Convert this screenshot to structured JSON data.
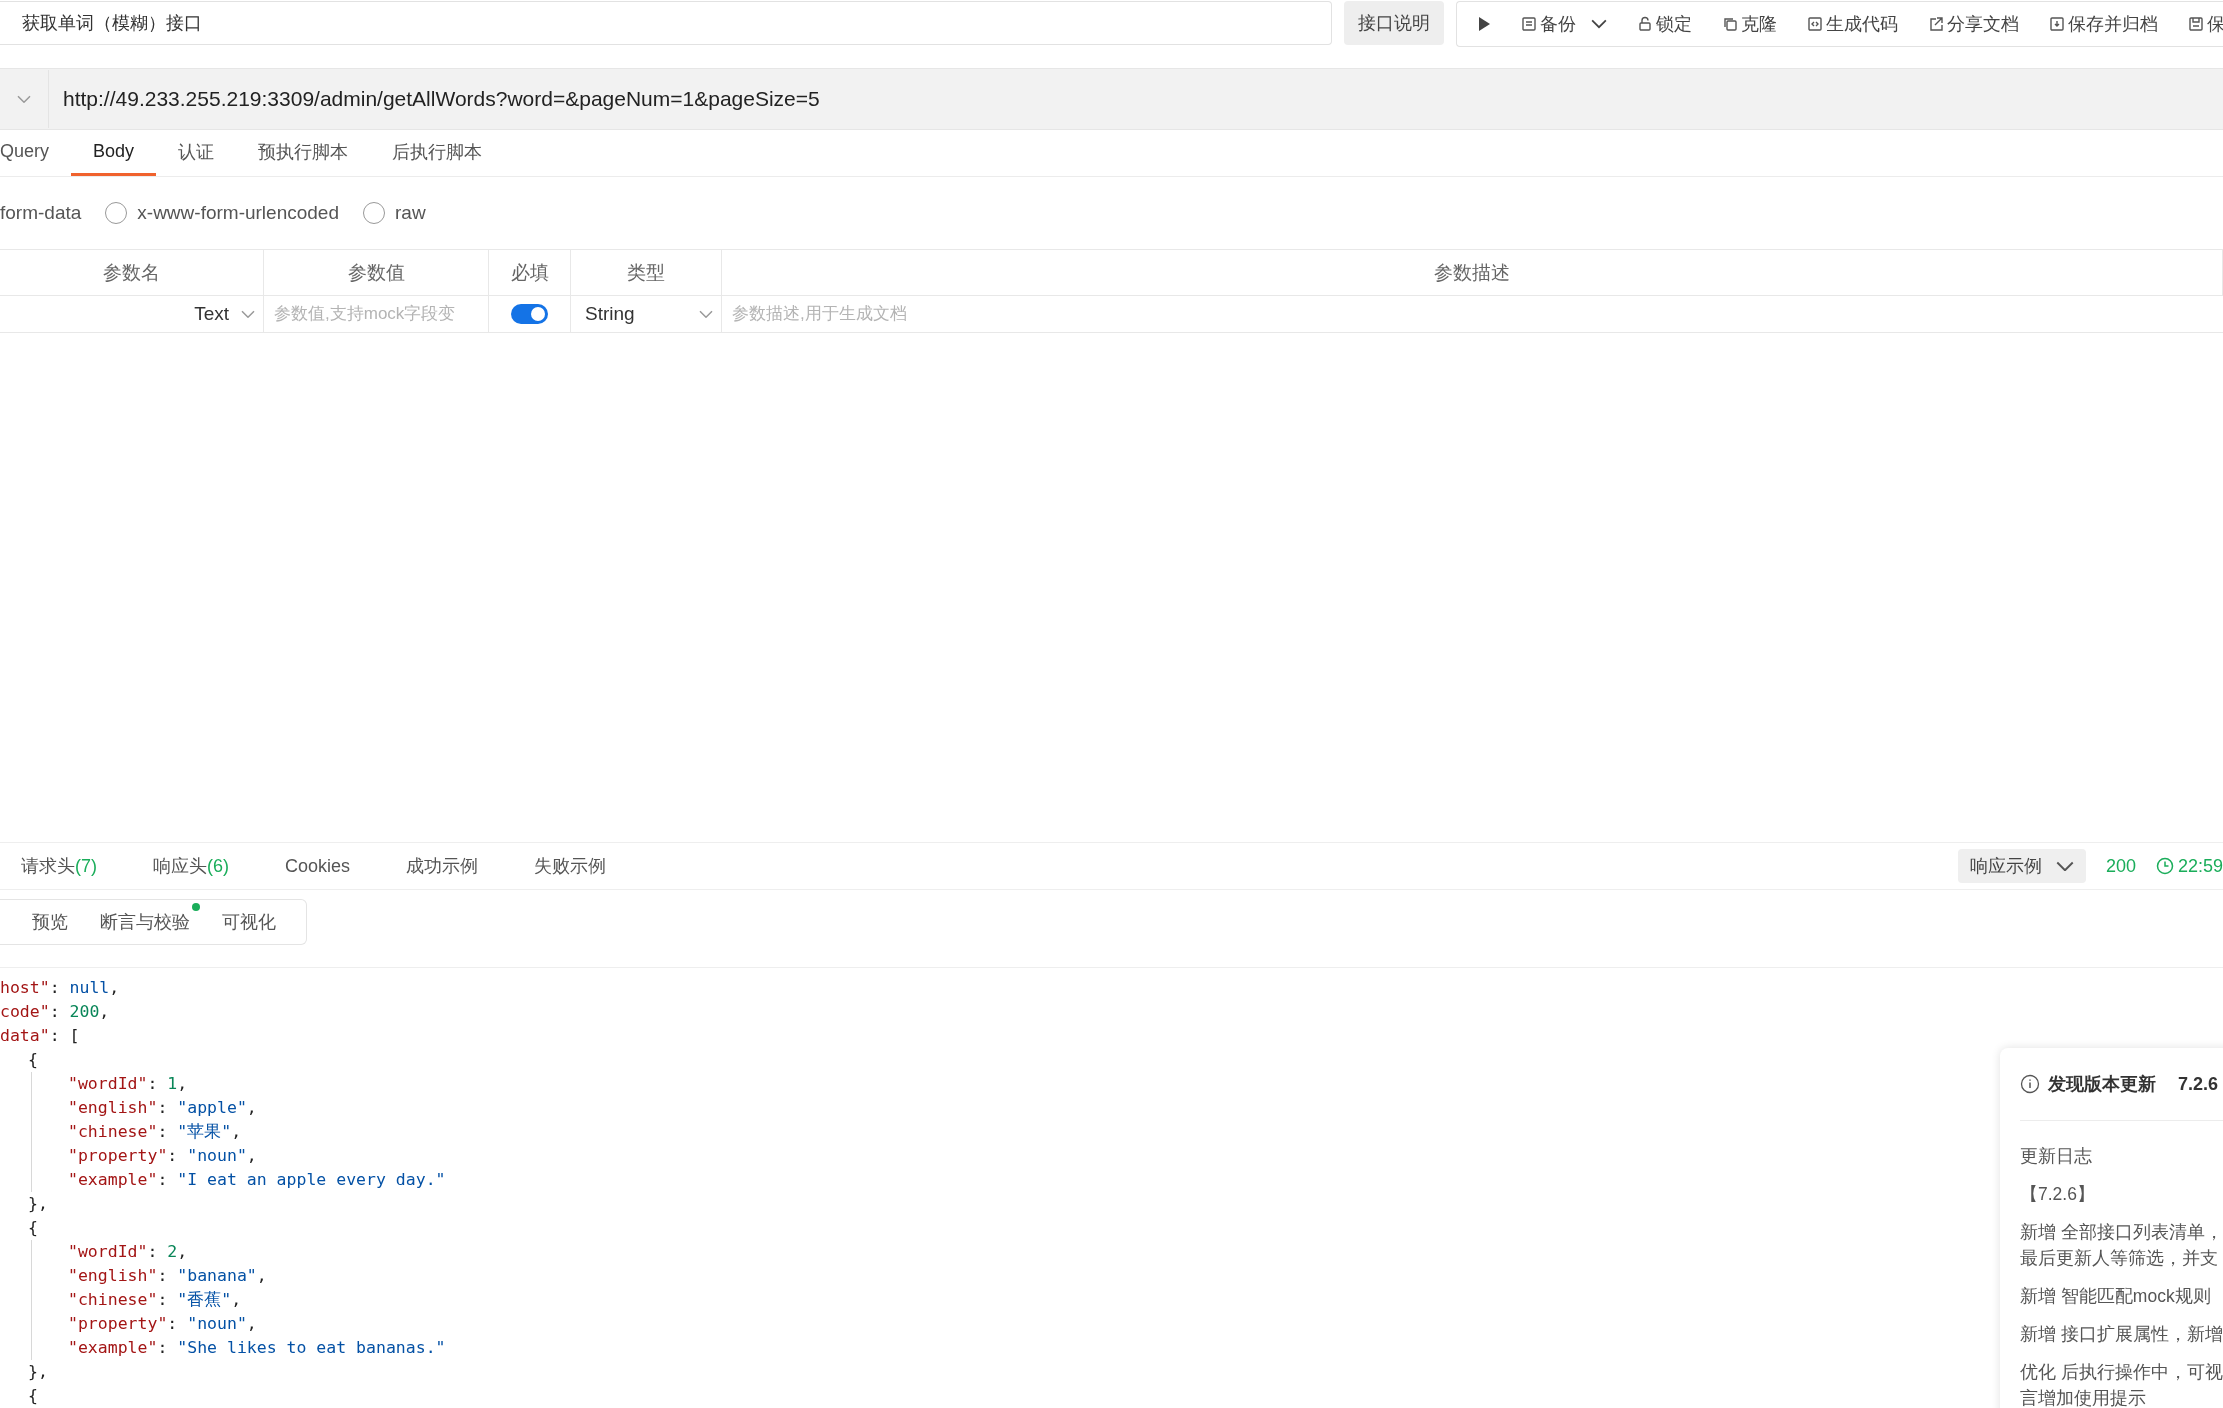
{
  "title_field": {
    "value": "获取单词（模糊）接口"
  },
  "doc_button": "接口说明",
  "toolbar": [
    {
      "kind": "run"
    },
    {
      "kind": "item",
      "label": "备份",
      "caret": true
    },
    {
      "kind": "item",
      "label": "锁定",
      "caret": false
    },
    {
      "kind": "item",
      "label": "克隆",
      "caret": false
    },
    {
      "kind": "item",
      "label": "生成代码",
      "caret": false
    },
    {
      "kind": "item",
      "label": "分享文档",
      "caret": false
    },
    {
      "kind": "item",
      "label": "保存并归档",
      "caret": false
    },
    {
      "kind": "item",
      "label": "保",
      "caret": false
    }
  ],
  "url": "http://49.233.255.219:3309/admin/getAllWords?word=&pageNum=1&pageSize=5",
  "request_tabs": [
    {
      "label": "Query",
      "selected": false
    },
    {
      "label": "Body",
      "selected": true
    },
    {
      "label": "认证",
      "selected": false
    },
    {
      "label": "预执行脚本",
      "selected": false
    },
    {
      "label": "后执行脚本",
      "selected": false
    }
  ],
  "body_modes": [
    {
      "kind": "label",
      "label": "form-data"
    },
    {
      "kind": "radio",
      "label": "x-www-form-urlencoded",
      "selected": false
    },
    {
      "kind": "radio",
      "label": "raw",
      "selected": false
    }
  ],
  "params_table": {
    "columns": [
      "参数名",
      "参数值",
      "必填",
      "类型",
      "参数描述"
    ],
    "rows": [
      {
        "field_type": "Text",
        "value_placeholder": "参数值,支持mock字段变",
        "required": true,
        "type": "String",
        "description_placeholder": "参数描述,用于生成文档"
      }
    ]
  },
  "response_tabs": [
    {
      "label": "请求头",
      "count": "(7)"
    },
    {
      "label": "响应头",
      "count": "(6)"
    },
    {
      "label": "Cookies"
    },
    {
      "label": "成功示例"
    },
    {
      "label": "失败示例"
    }
  ],
  "response_example_select": "响应示例",
  "status_code": "200",
  "time": "22:59",
  "view_tabs": [
    {
      "label": "预览",
      "dot": false
    },
    {
      "label": "断言与校验",
      "dot": true
    },
    {
      "label": "可视化",
      "dot": false
    }
  ],
  "code": [
    {
      "segments": [
        {
          "kind": "key",
          "text": "host\""
        },
        {
          "kind": "punct",
          "text": ": "
        },
        {
          "kind": "literal",
          "text": "null"
        },
        {
          "kind": "punct",
          "text": ","
        }
      ]
    },
    {
      "segments": [
        {
          "kind": "key",
          "text": "code\""
        },
        {
          "kind": "punct",
          "text": ": "
        },
        {
          "kind": "number",
          "text": "200"
        },
        {
          "kind": "punct",
          "text": ","
        }
      ]
    },
    {
      "segments": [
        {
          "kind": "key",
          "text": "data\""
        },
        {
          "kind": "punct",
          "text": ": ["
        }
      ],
      "children": [
        {
          "segments": [
            {
              "kind": "punct",
              "text": "{"
            }
          ],
          "children": [
            {
              "segments": [
                {
                  "kind": "key",
                  "text": "\"wordId\""
                },
                {
                  "kind": "punct",
                  "text": ": "
                },
                {
                  "kind": "number",
                  "text": "1"
                },
                {
                  "kind": "punct",
                  "text": ","
                }
              ]
            },
            {
              "segments": [
                {
                  "kind": "key",
                  "text": "\"english\""
                },
                {
                  "kind": "punct",
                  "text": ": "
                },
                {
                  "kind": "string",
                  "text": "\"apple\""
                },
                {
                  "kind": "punct",
                  "text": ","
                }
              ]
            },
            {
              "segments": [
                {
                  "kind": "key",
                  "text": "\"chinese\""
                },
                {
                  "kind": "punct",
                  "text": ": "
                },
                {
                  "kind": "string",
                  "text": "\"苹果\""
                },
                {
                  "kind": "punct",
                  "text": ","
                }
              ]
            },
            {
              "segments": [
                {
                  "kind": "key",
                  "text": "\"property\""
                },
                {
                  "kind": "punct",
                  "text": ": "
                },
                {
                  "kind": "string",
                  "text": "\"noun\""
                },
                {
                  "kind": "punct",
                  "text": ","
                }
              ]
            },
            {
              "segments": [
                {
                  "kind": "key",
                  "text": "\"example\""
                },
                {
                  "kind": "punct",
                  "text": ": "
                },
                {
                  "kind": "string",
                  "text": "\"I eat an apple every day.\""
                }
              ]
            }
          ]
        },
        {
          "segments": [
            {
              "kind": "punct",
              "text": "},"
            }
          ]
        },
        {
          "segments": [
            {
              "kind": "punct",
              "text": "{"
            }
          ],
          "children": [
            {
              "segments": [
                {
                  "kind": "key",
                  "text": "\"wordId\""
                },
                {
                  "kind": "punct",
                  "text": ": "
                },
                {
                  "kind": "number",
                  "text": "2"
                },
                {
                  "kind": "punct",
                  "text": ","
                }
              ]
            },
            {
              "segments": [
                {
                  "kind": "key",
                  "text": "\"english\""
                },
                {
                  "kind": "punct",
                  "text": ": "
                },
                {
                  "kind": "string",
                  "text": "\"banana\""
                },
                {
                  "kind": "punct",
                  "text": ","
                }
              ]
            },
            {
              "segments": [
                {
                  "kind": "key",
                  "text": "\"chinese\""
                },
                {
                  "kind": "punct",
                  "text": ": "
                },
                {
                  "kind": "string",
                  "text": "\"香蕉\""
                },
                {
                  "kind": "punct",
                  "text": ","
                }
              ]
            },
            {
              "segments": [
                {
                  "kind": "key",
                  "text": "\"property\""
                },
                {
                  "kind": "punct",
                  "text": ": "
                },
                {
                  "kind": "string",
                  "text": "\"noun\""
                },
                {
                  "kind": "punct",
                  "text": ","
                }
              ]
            },
            {
              "segments": [
                {
                  "kind": "key",
                  "text": "\"example\""
                },
                {
                  "kind": "punct",
                  "text": ": "
                },
                {
                  "kind": "string",
                  "text": "\"She likes to eat bananas.\""
                }
              ]
            }
          ]
        },
        {
          "segments": [
            {
              "kind": "punct",
              "text": "},"
            }
          ]
        },
        {
          "segments": [
            {
              "kind": "punct",
              "text": "{"
            }
          ]
        }
      ]
    }
  ],
  "update_panel": {
    "title": "发现版本更新",
    "version": "7.2.6",
    "heading": "更新日志",
    "version_tag": "【7.2.6】",
    "notes": [
      {
        "lines": [
          "新增 全部接口列表清单，",
          "最后更新人等筛选，并支"
        ]
      },
      {
        "lines": [
          "新增 智能匹配mock规则"
        ]
      },
      {
        "lines": [
          "新增 接口扩展属性，新增"
        ]
      },
      {
        "lines": [
          "优化 后执行操作中，可视",
          "言增加使用提示"
        ]
      }
    ]
  }
}
